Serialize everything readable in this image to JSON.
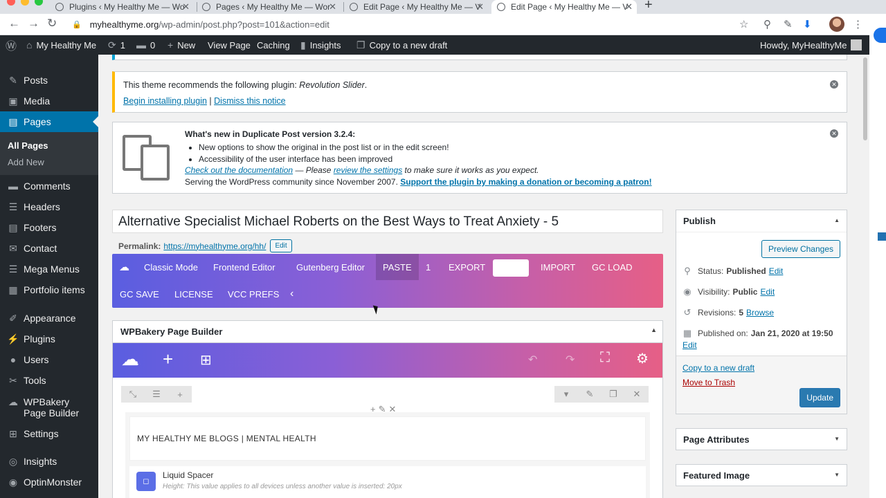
{
  "browser": {
    "tabs": [
      {
        "title": "Plugins ‹ My Healthy Me — Wo"
      },
      {
        "title": "Pages ‹ My Healthy Me — Wor"
      },
      {
        "title": "Edit Page ‹ My Healthy Me — V"
      },
      {
        "title": "Edit Page ‹ My Healthy Me — V"
      }
    ],
    "url_host": "myhealthyme.org",
    "url_path": "/wp-admin/post.php?post=101&action=edit"
  },
  "adminbar": {
    "site_name": "My Healthy Me",
    "updates_count": "1",
    "comments_count": "0",
    "new_label": "New",
    "view_page": "View Page",
    "caching": "Caching",
    "insights": "Insights",
    "copy_draft": "Copy to a new draft",
    "howdy": "Howdy, MyHealthyMe"
  },
  "sidebar": {
    "items": [
      {
        "label": "Posts",
        "icon": "pin-icon"
      },
      {
        "label": "Media",
        "icon": "media-icon"
      },
      {
        "label": "Pages",
        "icon": "pages-icon"
      },
      {
        "label": "Comments",
        "icon": "comments-icon"
      },
      {
        "label": "Headers",
        "icon": "headers-icon"
      },
      {
        "label": "Footers",
        "icon": "footers-icon"
      },
      {
        "label": "Contact",
        "icon": "mail-icon"
      },
      {
        "label": "Mega Menus",
        "icon": "menu-icon"
      },
      {
        "label": "Portfolio items",
        "icon": "portfolio-icon"
      },
      {
        "label": "Appearance",
        "icon": "brush-icon"
      },
      {
        "label": "Plugins",
        "icon": "plugin-icon"
      },
      {
        "label": "Users",
        "icon": "user-icon"
      },
      {
        "label": "Tools",
        "icon": "wrench-icon"
      },
      {
        "label": "WPBakery Page Builder",
        "icon": "wpbakery-icon"
      },
      {
        "label": "Settings",
        "icon": "settings-icon"
      },
      {
        "label": "Insights",
        "icon": "insights-icon"
      },
      {
        "label": "OptinMonster",
        "icon": "optinmonster-icon"
      }
    ],
    "sub": {
      "all_pages": "All Pages",
      "add_new": "Add New"
    }
  },
  "notices": {
    "plugin_recommend_prefix": "This theme recommends the following plugin: ",
    "plugin_name": "Revolution Slider",
    "begin_installing": "Begin installing plugin",
    "sep": "|",
    "dismiss": "Dismiss this notice",
    "dup_title": "What's new in Duplicate Post version 3.2.4:",
    "dup_bullets": [
      "New options to show the original in the post list or in the edit screen!",
      "Accessibility of the user interface has been improved"
    ],
    "check_docs": "Check out the documentation",
    "please": " — Please ",
    "review_settings": "review the settings",
    "make_sure": " to make sure it works as you expect.",
    "serving": "Serving the WordPress community since November 2007. ",
    "support": "Support the plugin by making a donation or becoming a patron!"
  },
  "editor": {
    "title": "Alternative Specialist Michael Roberts on the Best Ways to Treat Anxiety - 5",
    "permalink_label": "Permalink:",
    "permalink_url": "https://myhealthyme.org/hh/",
    "edit_label": "Edit",
    "toolbar": {
      "classic": "Classic Mode",
      "frontend": "Frontend Editor",
      "gutenberg": "Gutenberg Editor",
      "paste": "PASTE",
      "paste_count": "1",
      "export": "EXPORT",
      "import": "IMPORT",
      "gc_load": "GC LOAD",
      "gc_save": "GC SAVE",
      "license": "LICENSE",
      "vcc_prefs": "VCC PREFS"
    }
  },
  "wpbakery": {
    "title": "WPBakery Page Builder",
    "heading_text": "MY HEALTHY ME BLOGS | MENTAL HEALTH",
    "spacer_name": "Liquid Spacer",
    "spacer_desc": "Height: This value applies to all devices unless another value is inserted: 20px"
  },
  "publish": {
    "title": "Publish",
    "preview": "Preview Changes",
    "status_label": "Status:",
    "status_value": "Published",
    "visibility_label": "Visibility:",
    "visibility_value": "Public",
    "revisions_label": "Revisions:",
    "revisions_value": "5",
    "browse": "Browse",
    "published_label": "Published on:",
    "published_value": "Jan 21, 2020 at 19:50",
    "edit": "Edit",
    "copy_draft": "Copy to a new draft",
    "trash": "Move to Trash",
    "update": "Update"
  },
  "page_attributes": {
    "title": "Page Attributes"
  },
  "featured_image": {
    "title": "Featured Image"
  },
  "colors": {
    "admin_bar": "#23282d",
    "accent": "#0073aa",
    "gradient_start": "#5a5ee0",
    "gradient_end": "#e65f86"
  }
}
